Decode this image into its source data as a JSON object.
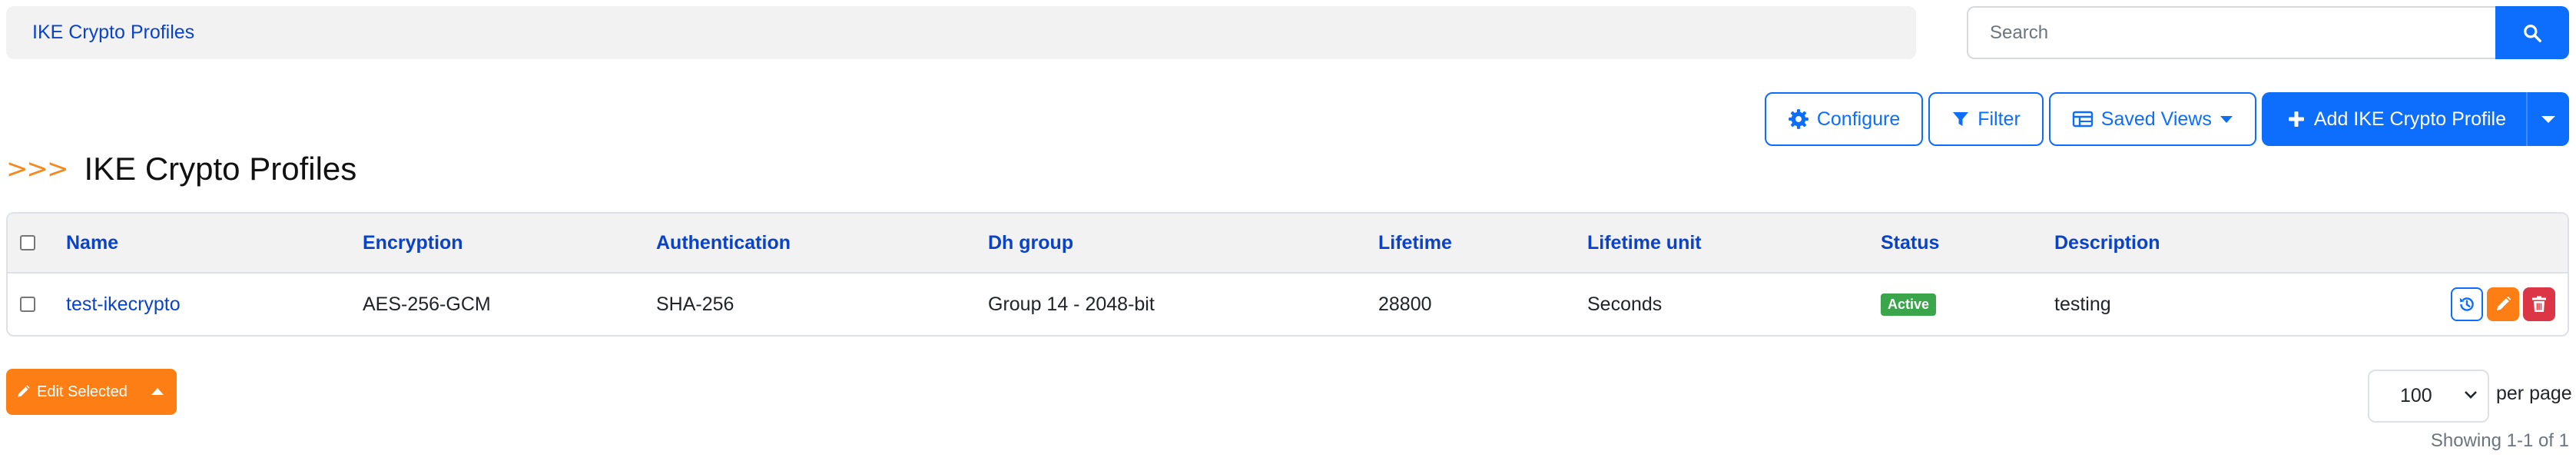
{
  "breadcrumb": {
    "label": "IKE Crypto Profiles"
  },
  "search": {
    "placeholder": "Search"
  },
  "toolbar": {
    "configure_label": "Configure",
    "filter_label": "Filter",
    "saved_views_label": "Saved Views",
    "add_label": "Add IKE Crypto Profile"
  },
  "page": {
    "arrows": ">>>",
    "title": "IKE Crypto Profiles"
  },
  "table": {
    "columns": [
      "Name",
      "Encryption",
      "Authentication",
      "Dh group",
      "Lifetime",
      "Lifetime unit",
      "Status",
      "Description"
    ],
    "rows": [
      {
        "name": "test-ikecrypto",
        "encryption": "AES-256-GCM",
        "authentication": "SHA-256",
        "dh_group": "Group 14 - 2048-bit",
        "lifetime": "28800",
        "lifetime_unit": "Seconds",
        "status": "Active",
        "description": "testing"
      }
    ]
  },
  "footer": {
    "edit_selected_label": "Edit Selected",
    "per_page_value": "100",
    "per_page_label": "per page",
    "showing": "Showing 1-1 of 1"
  },
  "colors": {
    "primary": "#0d6efd",
    "link": "#0a43c9",
    "orange": "#fd7e14",
    "danger": "#dc3545",
    "success": "#3aa54a"
  }
}
